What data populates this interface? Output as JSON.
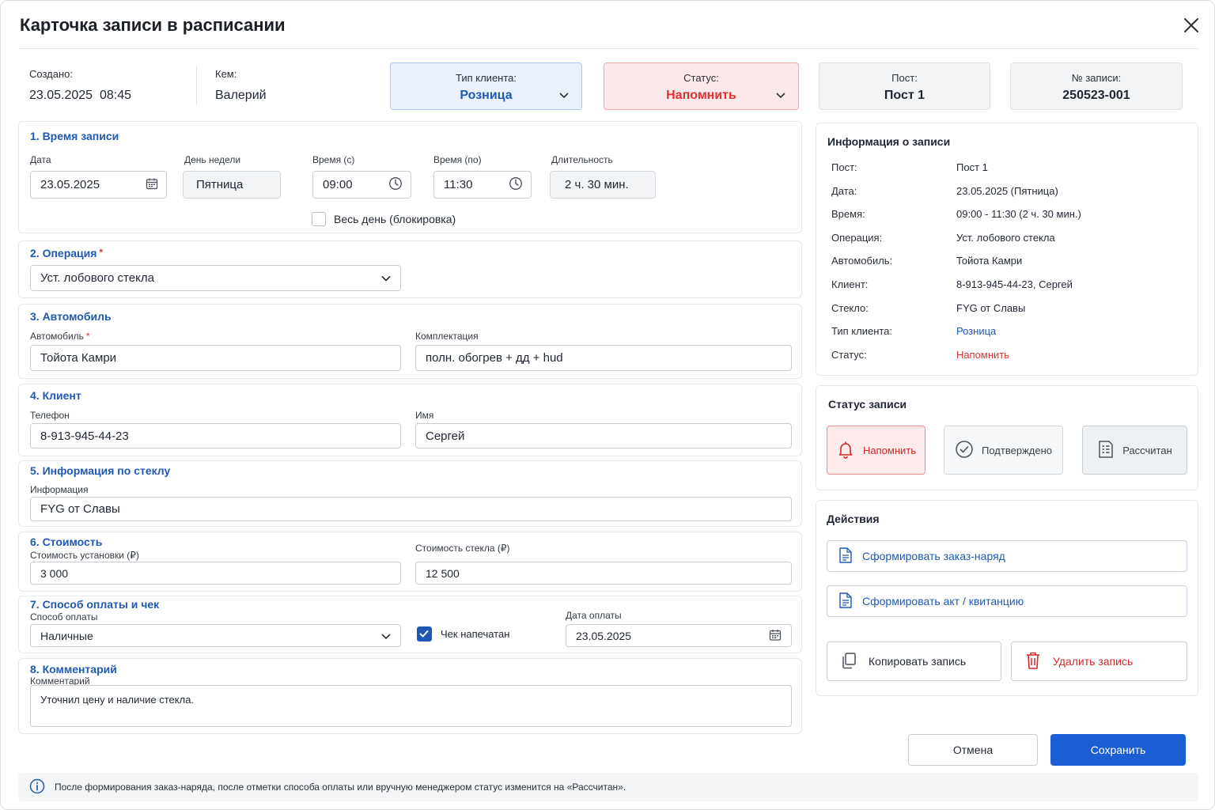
{
  "dialog": {
    "title": "Карточка записи в расписании",
    "close_icon": "close-icon"
  },
  "meta": {
    "created_label": "Создано:",
    "created_value": "23.05.2025  08:45",
    "by_label": "Кем:",
    "by_value": "Валерий",
    "client_type_label": "Тип клиента:",
    "client_type_value": "Розница",
    "status_label": "Статус:",
    "status_value": "Напомнить",
    "post_label": "Пост:",
    "post_value": "Пост 1",
    "record_no_label": "№ записи:",
    "record_no_value": "250523-001"
  },
  "time": {
    "title": "1. Время записи",
    "date_label": "Дата",
    "date_value": "23.05.2025",
    "weekday_label": "День недели",
    "weekday_value": "Пятница",
    "from_label": "Время (с)",
    "from_value": "09:00",
    "to_label": "Время (по)",
    "to_value": "11:30",
    "duration_label": "Длительность",
    "duration_value": "2 ч. 30 мин.",
    "allday_label": "Весь день (блокировка)",
    "allday_checked": false
  },
  "operation": {
    "title": "2. Операция",
    "required_mark": "*",
    "value": "Уст. лобового стекла"
  },
  "car": {
    "title": "3. Автомобиль",
    "car_label": "Автомобиль",
    "required_mark": "*",
    "car_value": "Тойота Камри",
    "config_label": "Комплектация",
    "config_value": "полн. обогрев + дд + hud"
  },
  "client": {
    "title": "4. Клиент",
    "phone_label": "Телефон",
    "phone_value": "8-913-945-44-23",
    "name_label": "Имя",
    "name_value": "Сергей"
  },
  "glass": {
    "title": "5. Информация по стеклу",
    "info_label": "Информация",
    "info_value": "FYG от Славы"
  },
  "cost": {
    "title": "6. Стоимость",
    "install_label": "Стоимость установки (₽)",
    "install_value": "3 000",
    "glass_label": "Стоимость стекла (₽)",
    "glass_value": "12 500"
  },
  "payment": {
    "title": "7. Способ оплаты и чек",
    "method_label": "Способ оплаты",
    "method_value": "Наличные",
    "receipt_label": "Чек напечатан",
    "receipt_checked": true,
    "pay_date_label": "Дата оплаты",
    "pay_date_value": "23.05.2025"
  },
  "comment": {
    "title": "8. Комментарий",
    "label": "Комментарий",
    "value": "Уточнил цену и наличие стекла."
  },
  "info_panel": {
    "title": "Информация о записи",
    "rows": [
      {
        "label": "Пост:",
        "value": "Пост 1"
      },
      {
        "label": "Дата:",
        "value": "23.05.2025 (Пятница)"
      },
      {
        "label": "Время:",
        "value": "09:00 - 11:30 (2 ч. 30 мин.)"
      },
      {
        "label": "Операция:",
        "value": "Уст. лобового стекла"
      },
      {
        "label": "Автомобиль:",
        "value": "Тойота Камри"
      },
      {
        "label": "Клиент:",
        "value": "8-913-945-44-23, Сергей"
      },
      {
        "label": "Стекло:",
        "value": "FYG от Славы"
      },
      {
        "label": "Тип клиента:",
        "value": "Розница"
      },
      {
        "label": "Статус:",
        "value": "Напомнить"
      }
    ]
  },
  "status_panel": {
    "title": "Статус записи",
    "remind": "Напомнить",
    "confirmed": "Подтверждено",
    "calculated": "Рассчитан"
  },
  "actions": {
    "title": "Действия",
    "work_order": "Сформировать заказ-наряд",
    "act": "Сформировать акт / квитанцию",
    "copy": "Копировать запись",
    "delete": "Удалить запись"
  },
  "buttons": {
    "cancel": "Отмена",
    "save": "Сохранить"
  },
  "footer": {
    "text": "После формирования заказ-наряда, после отметки способа оплаты или вручную менеджером статус изменится на «Рассчитан»."
  },
  "colors": {
    "accent": "#1f59b5",
    "primary_button": "#1a5ed1",
    "danger": "#e03131",
    "client_type_bg": "#eaf2fd",
    "status_bg": "#fde9e9"
  }
}
